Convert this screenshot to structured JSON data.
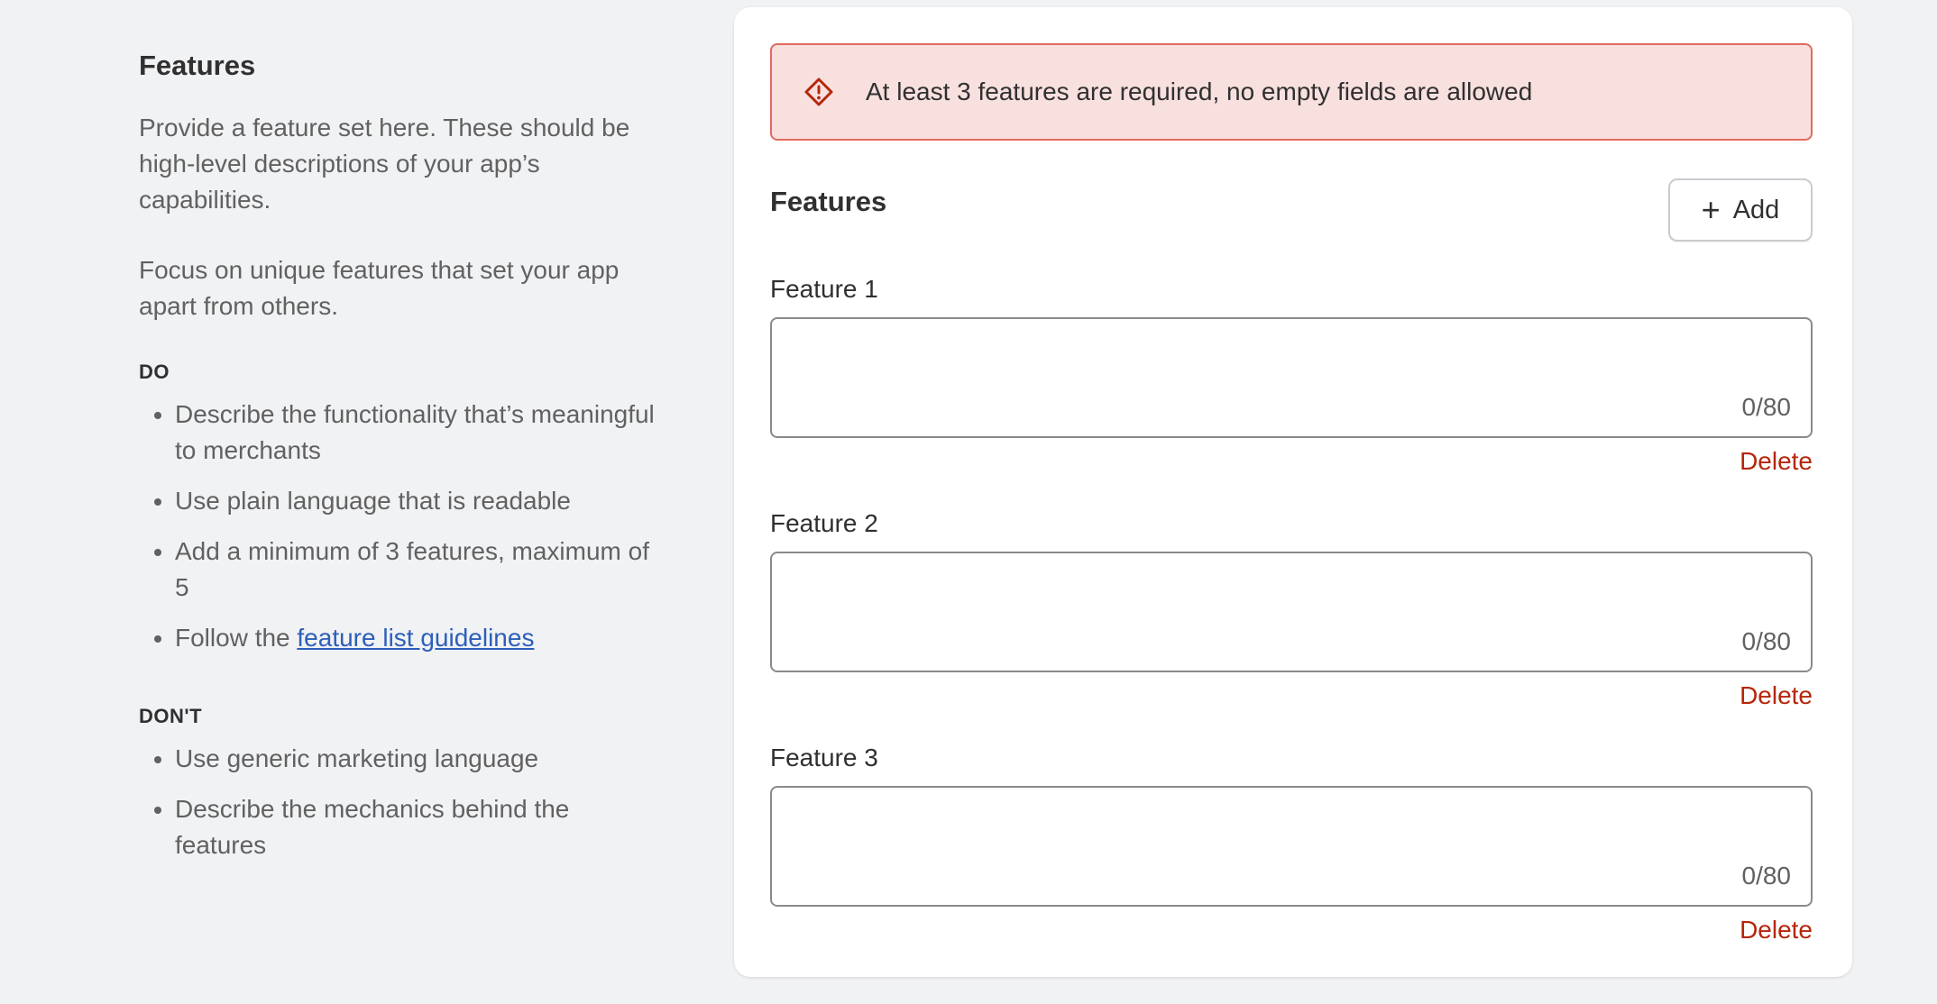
{
  "info": {
    "title": "Features",
    "paragraphs": [
      "Provide a feature set here. These should be high-level descriptions of your app’s capabilities.",
      "Focus on unique features that set your app apart from others."
    ],
    "do_title": "DO",
    "do_items": [
      "Describe the functionality that’s meaningful to merchants",
      "Use plain language that is readable",
      "Add a minimum of 3 features, maximum of 5"
    ],
    "do_last_prefix": "Follow the ",
    "do_last_link": "feature list guidelines",
    "dont_title": "DON'T",
    "dont_items": [
      "Use generic marketing language",
      "Describe the mechanics behind the features"
    ]
  },
  "banner": {
    "message": "At least 3 features are required, no empty fields are allowed",
    "icon": "alert-diamond-icon",
    "color": "#b5260b"
  },
  "form": {
    "title": "Features",
    "add_label": "Add",
    "add_icon": "plus-icon",
    "fields": [
      {
        "label": "Feature 1",
        "value": "",
        "counter": "0/80",
        "delete_label": "Delete"
      },
      {
        "label": "Feature 2",
        "value": "",
        "counter": "0/80",
        "delete_label": "Delete"
      },
      {
        "label": "Feature 3",
        "value": "",
        "counter": "0/80",
        "delete_label": "Delete"
      }
    ]
  }
}
